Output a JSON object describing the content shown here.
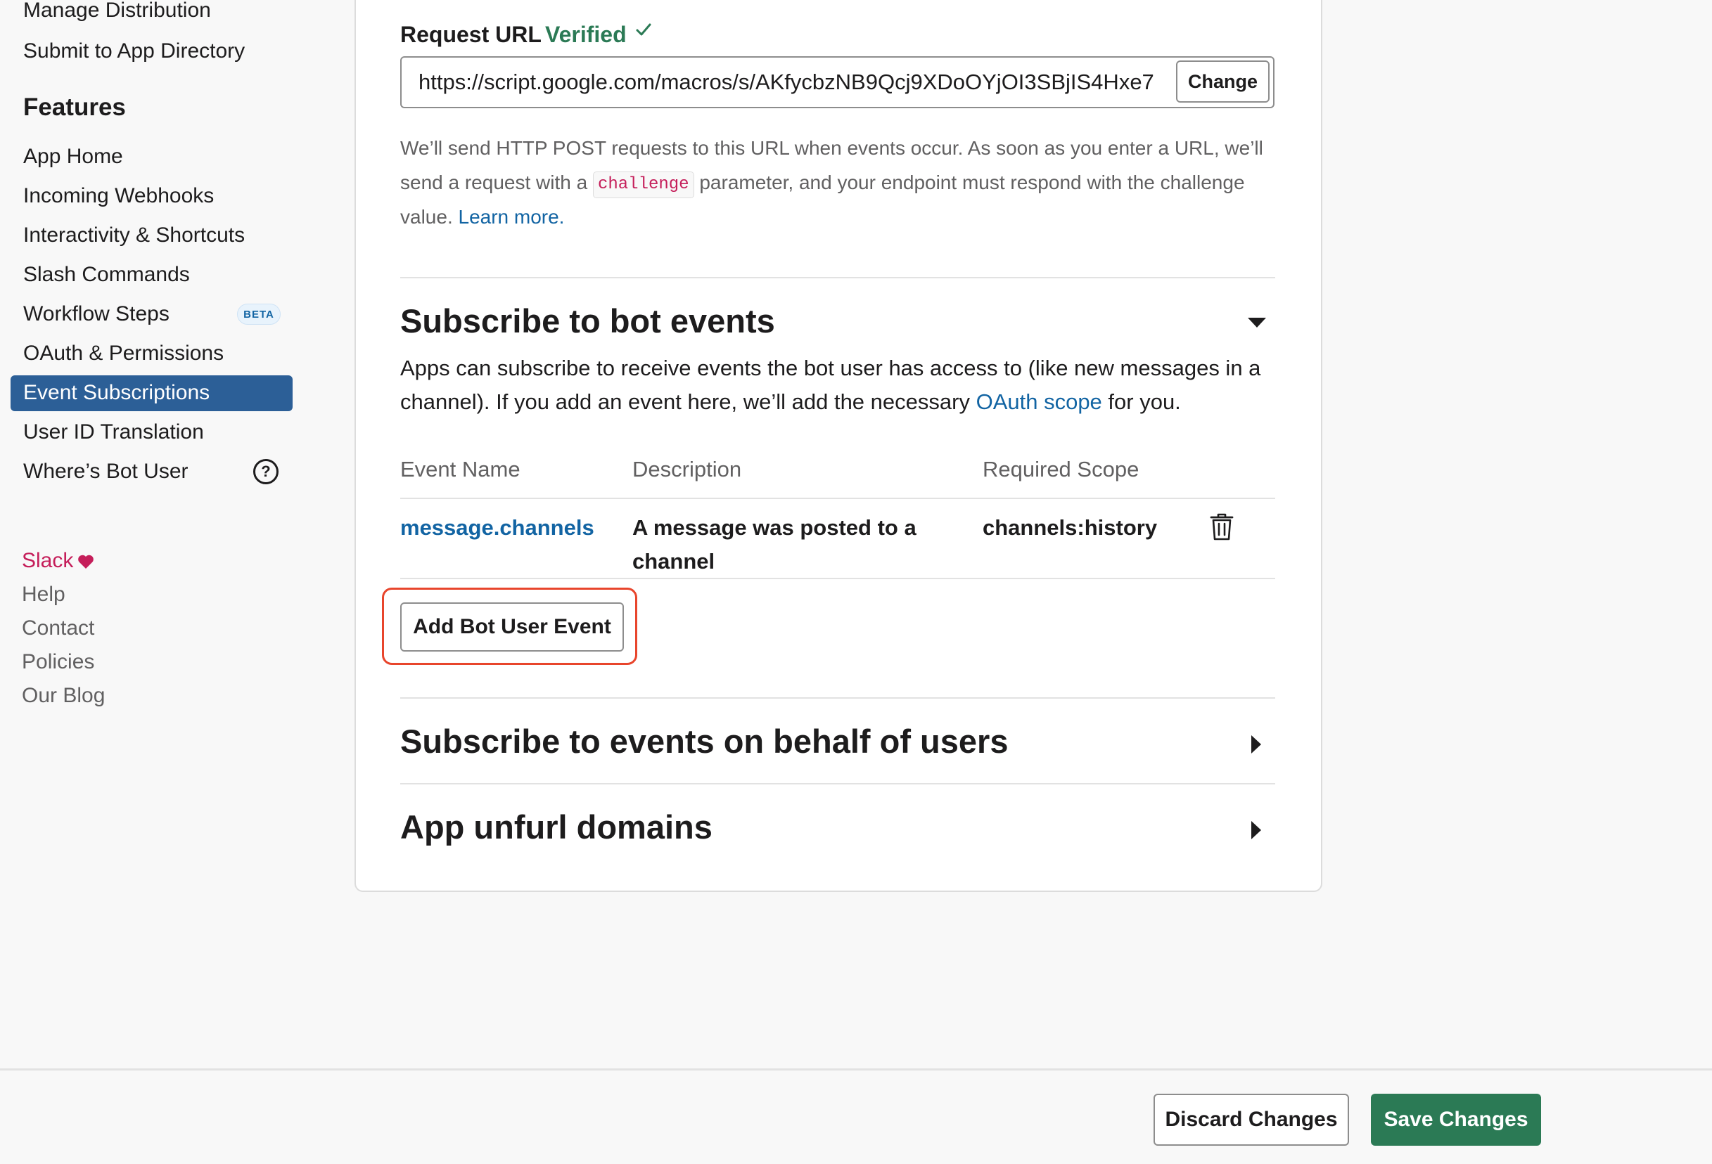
{
  "sidebar": {
    "settings_items": [
      {
        "label": "Manage Distribution"
      },
      {
        "label": "Submit to App Directory"
      }
    ],
    "features_heading": "Features",
    "feature_items": [
      {
        "label": "App Home"
      },
      {
        "label": "Incoming Webhooks"
      },
      {
        "label": "Interactivity & Shortcuts"
      },
      {
        "label": "Slash Commands"
      },
      {
        "label": "Workflow Steps",
        "badge": "BETA"
      },
      {
        "label": "OAuth & Permissions"
      },
      {
        "label": "Event Subscriptions",
        "active": true
      },
      {
        "label": "User ID Translation"
      },
      {
        "label": "Where’s Bot User",
        "help_icon": "?"
      }
    ],
    "footer_links": [
      {
        "label": "Slack",
        "icon": "heart-icon"
      },
      {
        "label": "Help"
      },
      {
        "label": "Contact"
      },
      {
        "label": "Policies"
      },
      {
        "label": "Our Blog"
      }
    ]
  },
  "request_url": {
    "label": "Request URL",
    "status": "Verified",
    "value": "https://script.google.com/macros/s/AKfycbzNB9Qcj9XDoOYjOI3SBjIS4Hxe7",
    "change_label": "Change",
    "help_before": "We’ll send HTTP POST requests to this URL when events occur. As soon as you enter a URL, we’ll send a request with a ",
    "help_code": "challenge",
    "help_after": " parameter, and your endpoint must respond with the challenge value. ",
    "learn_more": "Learn more."
  },
  "bot_events": {
    "title": "Subscribe to bot events",
    "desc_before": "Apps can subscribe to receive events the bot user has access to (like new messages in a channel). If you add an event here, we’ll add the necessary ",
    "desc_link": "OAuth scope",
    "desc_after": " for you.",
    "columns": {
      "event_name": "Event Name",
      "description": "Description",
      "required_scope": "Required Scope"
    },
    "rows": [
      {
        "event_name": "message.channels",
        "description": "A message was posted to a channel",
        "scope": "channels:history"
      }
    ],
    "add_button": "Add Bot User Event"
  },
  "user_events": {
    "title": "Subscribe to events on behalf of users"
  },
  "unfurl": {
    "title": "App unfurl domains"
  },
  "footer": {
    "discard_label": "Discard Changes",
    "save_label": "Save Changes"
  },
  "colors": {
    "active_nav": "#2c5f97",
    "verified": "#2b7a55",
    "link": "#1264a3",
    "save_button": "#2b7a55",
    "highlight": "#e8452c"
  }
}
